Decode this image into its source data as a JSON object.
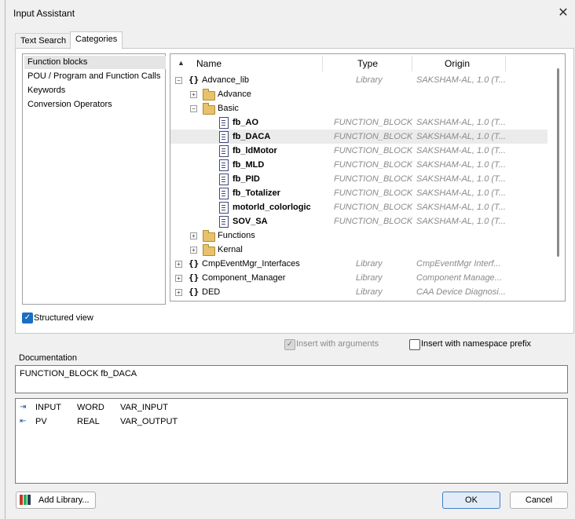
{
  "window": {
    "title": "Input Assistant"
  },
  "tabs": [
    {
      "label": "Text Search"
    },
    {
      "label": "Categories"
    }
  ],
  "categories": [
    {
      "label": "Function blocks"
    },
    {
      "label": "POU / Program and Function Calls"
    },
    {
      "label": "Keywords"
    },
    {
      "label": "Conversion Operators"
    }
  ],
  "tree": {
    "columns": {
      "name": "Name",
      "type": "Type",
      "origin": "Origin"
    },
    "rows": [
      {
        "name": "Advance_lib",
        "type": "Library",
        "origin": "SAKSHAM-AL, 1.0 (T..."
      },
      {
        "name": "Advance",
        "type": "",
        "origin": ""
      },
      {
        "name": "Basic",
        "type": "",
        "origin": ""
      },
      {
        "name": "fb_AO",
        "type": "FUNCTION_BLOCK",
        "origin": "SAKSHAM-AL, 1.0 (T..."
      },
      {
        "name": "fb_DACA",
        "type": "FUNCTION_BLOCK",
        "origin": "SAKSHAM-AL, 1.0 (T..."
      },
      {
        "name": "fb_ldMotor",
        "type": "FUNCTION_BLOCK",
        "origin": "SAKSHAM-AL, 1.0 (T..."
      },
      {
        "name": "fb_MLD",
        "type": "FUNCTION_BLOCK",
        "origin": "SAKSHAM-AL, 1.0 (T..."
      },
      {
        "name": "fb_PID",
        "type": "FUNCTION_BLOCK",
        "origin": "SAKSHAM-AL, 1.0 (T..."
      },
      {
        "name": "fb_Totalizer",
        "type": "FUNCTION_BLOCK",
        "origin": "SAKSHAM-AL, 1.0 (T..."
      },
      {
        "name": "motorld_colorlogic",
        "type": "FUNCTION_BLOCK",
        "origin": "SAKSHAM-AL, 1.0 (T..."
      },
      {
        "name": "SOV_SA",
        "type": "FUNCTION_BLOCK",
        "origin": "SAKSHAM-AL, 1.0 (T..."
      },
      {
        "name": "Functions",
        "type": "",
        "origin": ""
      },
      {
        "name": "Kernal",
        "type": "",
        "origin": ""
      },
      {
        "name": "CmpEventMgr_Interfaces",
        "type": "Library",
        "origin": "CmpEventMgr Interf..."
      },
      {
        "name": "Component_Manager",
        "type": "Library",
        "origin": "Component Manage..."
      },
      {
        "name": "DED",
        "type": "Library",
        "origin": "CAA Device Diagnosi..."
      }
    ]
  },
  "options": {
    "structured_view": "Structured view",
    "insert_with_arguments": "Insert with arguments",
    "insert_with_namespace_prefix": "Insert with namespace prefix"
  },
  "documentation": {
    "label": "Documentation",
    "text": "FUNCTION_BLOCK fb_DACA"
  },
  "variables": [
    {
      "name": "INPUT",
      "type": "WORD",
      "kind": "VAR_INPUT"
    },
    {
      "name": "PV",
      "type": "REAL",
      "kind": "VAR_OUTPUT"
    }
  ],
  "buttons": {
    "add_library": "Add Library...",
    "ok": "OK",
    "cancel": "Cancel"
  },
  "colors": {
    "selection": "#e5e5e5",
    "checkbox_accent": "#1b6ec2",
    "folder": "#e8c26a"
  }
}
